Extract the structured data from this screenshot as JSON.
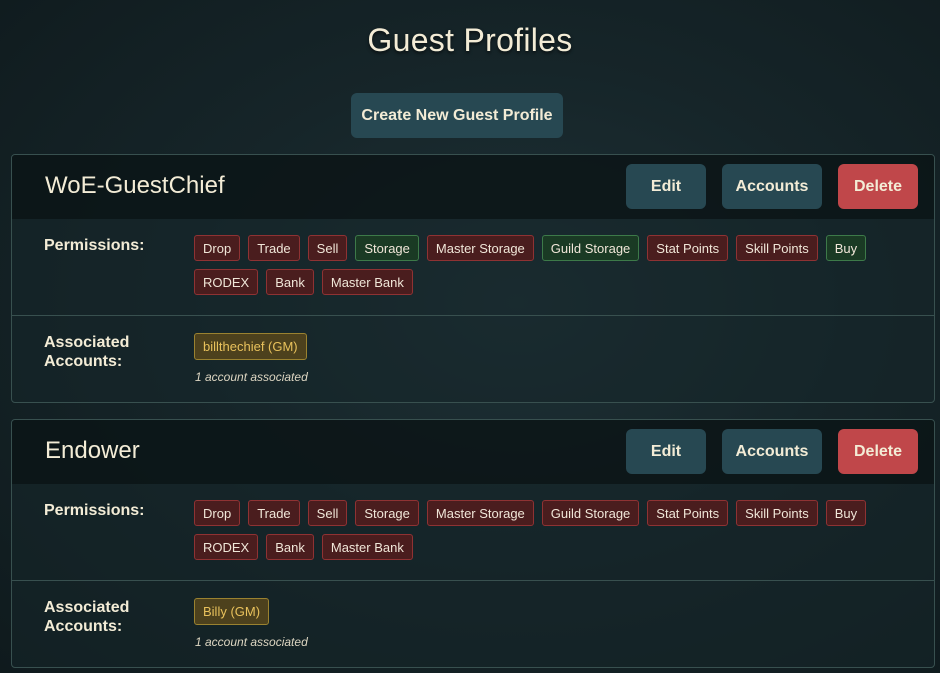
{
  "page": {
    "title": "Guest Profiles",
    "create_button": "Create New Guest Profile"
  },
  "labels": {
    "permissions": "Permissions:",
    "associated_line1": "Associated",
    "associated_line2": "Accounts:"
  },
  "profiles": [
    {
      "name": "WoE-GuestChief",
      "edit": "Edit",
      "accounts": "Accounts",
      "delete": "Delete",
      "permissions": [
        {
          "label": "Drop",
          "granted": false
        },
        {
          "label": "Trade",
          "granted": false
        },
        {
          "label": "Sell",
          "granted": false
        },
        {
          "label": "Storage",
          "granted": true
        },
        {
          "label": "Master Storage",
          "granted": false
        },
        {
          "label": "Guild Storage",
          "granted": true
        },
        {
          "label": "Stat Points",
          "granted": false
        },
        {
          "label": "Skill Points",
          "granted": false
        },
        {
          "label": "Buy",
          "granted": true
        },
        {
          "label": "RODEX",
          "granted": false
        },
        {
          "label": "Bank",
          "granted": false
        },
        {
          "label": "Master Bank",
          "granted": false
        }
      ],
      "account_tag": "billthechief  (GM)",
      "account_note": "1 account associated"
    },
    {
      "name": "Endower",
      "edit": "Edit",
      "accounts": "Accounts",
      "delete": "Delete",
      "permissions": [
        {
          "label": "Drop",
          "granted": false
        },
        {
          "label": "Trade",
          "granted": false
        },
        {
          "label": "Sell",
          "granted": false
        },
        {
          "label": "Storage",
          "granted": false
        },
        {
          "label": "Master Storage",
          "granted": false
        },
        {
          "label": "Guild Storage",
          "granted": false
        },
        {
          "label": "Stat Points",
          "granted": false
        },
        {
          "label": "Skill Points",
          "granted": false
        },
        {
          "label": "Buy",
          "granted": false
        },
        {
          "label": "RODEX",
          "granted": false
        },
        {
          "label": "Bank",
          "granted": false
        },
        {
          "label": "Master Bank",
          "granted": false
        }
      ],
      "account_tag": "Billy  (GM)",
      "account_note": "1 account associated"
    }
  ],
  "colors": {
    "denied_bg": "#4a1d1e",
    "granted_bg": "#1a3a24",
    "primary_button": "#274852",
    "delete_button": "#c0474a",
    "account_tag": "#4d411d"
  }
}
